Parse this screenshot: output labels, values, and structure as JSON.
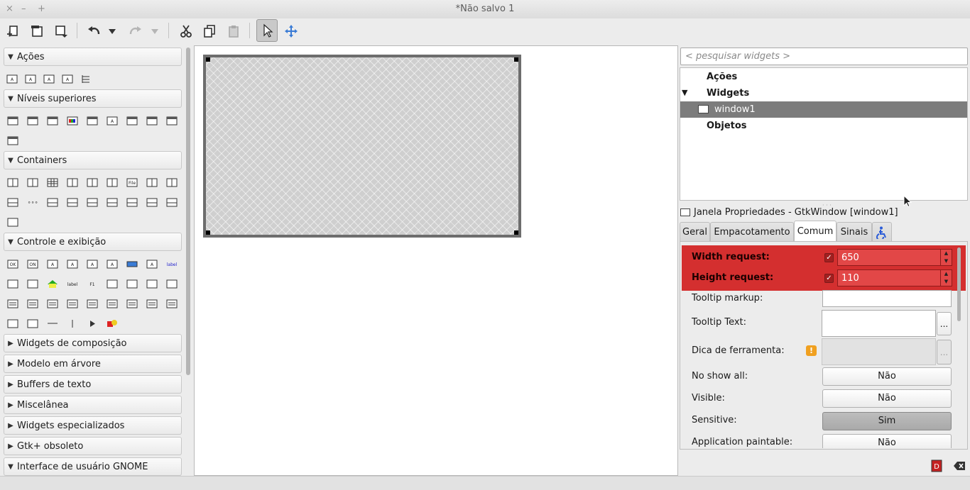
{
  "window": {
    "title": "*Não salvo 1",
    "controls": [
      "×",
      "–",
      "+"
    ]
  },
  "toolbar": {
    "buttons": [
      "new-icon",
      "open-icon",
      "save-icon",
      "undo-icon",
      "undo-menu-icon",
      "redo-icon",
      "redo-menu-icon",
      "cut-icon",
      "copy-icon",
      "paste-icon",
      "select-pointer-icon",
      "drag-resize-icon"
    ]
  },
  "palette": {
    "sections": [
      {
        "label": "Ações",
        "expanded": true
      },
      {
        "label": "Níveis superiores",
        "expanded": true
      },
      {
        "label": "Containers",
        "expanded": true
      },
      {
        "label": "Controle e exibição",
        "expanded": true
      },
      {
        "label": "Widgets de composição",
        "expanded": false
      },
      {
        "label": "Modelo em árvore",
        "expanded": false
      },
      {
        "label": "Buffers de texto",
        "expanded": false
      },
      {
        "label": "Miscelânea",
        "expanded": false
      },
      {
        "label": "Widgets especializados",
        "expanded": false
      },
      {
        "label": "Gtk+ obsoleto",
        "expanded": false
      },
      {
        "label": "Interface de usuário GNOME",
        "expanded": true
      }
    ],
    "small_labels": {
      "file": "File",
      "ok": "OK",
      "on": "ON",
      "label": "label",
      "f1": "F1"
    }
  },
  "inspector": {
    "search_placeholder": "< pesquisar widgets >",
    "tree": [
      {
        "label": "Ações",
        "bold": true
      },
      {
        "label": "Widgets",
        "bold": true,
        "expander": "▼"
      },
      {
        "label": "window1",
        "bold": false,
        "selected": true
      },
      {
        "label": "Objetos",
        "bold": true
      }
    ]
  },
  "properties": {
    "title": "Janela Propriedades - GtkWindow [window1]",
    "tabs": [
      "Geral",
      "Empacotamento",
      "Comum",
      "Sinais"
    ],
    "active_tab": "Comum",
    "highlight_color": "#d21b1b",
    "width_request": {
      "label": "Width request:",
      "checked": true,
      "value": "650"
    },
    "height_request": {
      "label": "Height request:",
      "checked": true,
      "value": "110"
    },
    "tooltip_markup": {
      "label": "Tooltip markup:"
    },
    "tooltip_text": {
      "label": "Tooltip Text:",
      "button": "..."
    },
    "dica": {
      "label": "Dica de ferramenta:",
      "button": "..."
    },
    "no_show_all": {
      "label": "No show all:",
      "value": "Não"
    },
    "visible": {
      "label": "Visible:",
      "value": "Não"
    },
    "sensitive": {
      "label": "Sensitive:",
      "value": "Sim"
    },
    "app_paintable": {
      "label": "Application paintable:",
      "value": "Não"
    }
  }
}
